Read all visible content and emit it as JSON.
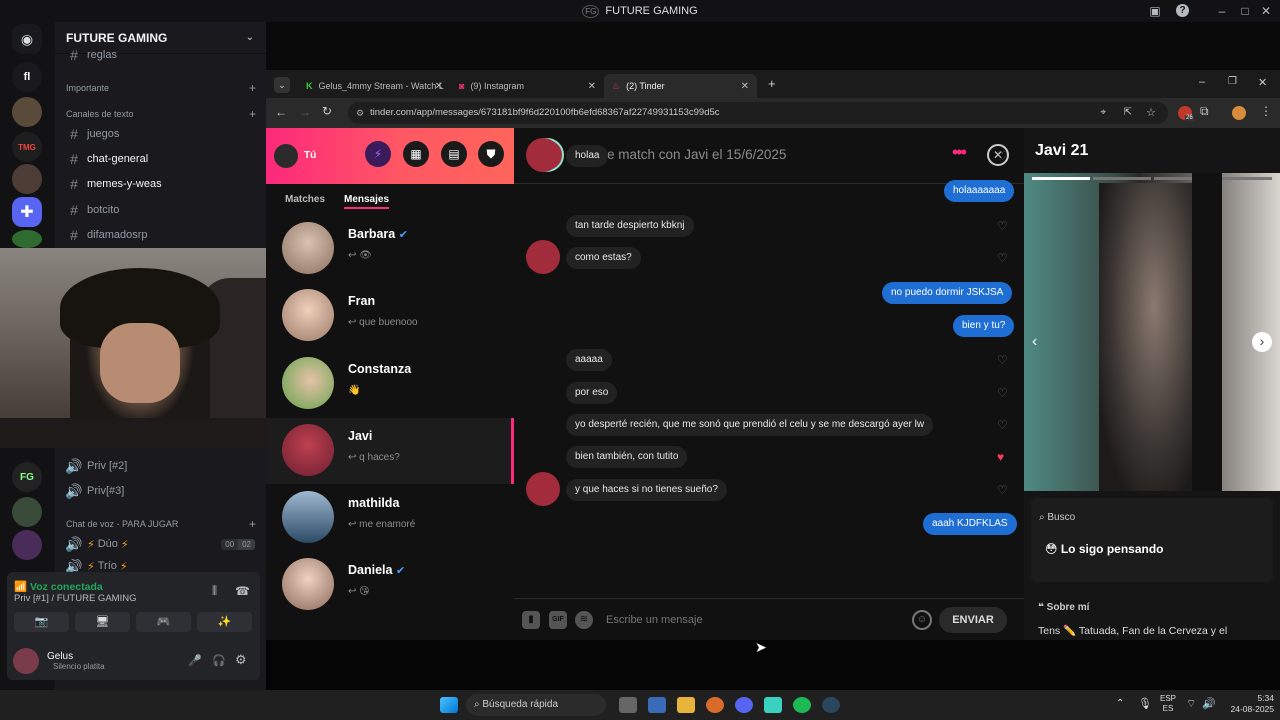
{
  "window": {
    "title": "FUTURE GAMING",
    "logo": "FG"
  },
  "discord": {
    "server_name": "FUTURE GAMING",
    "server_tags": {
      "tmg": "TMG",
      "fg": "FG"
    },
    "channels": [
      {
        "name": "reglas",
        "type": "text"
      },
      {
        "name": "juegos",
        "type": "text"
      },
      {
        "name": "chat-general",
        "type": "text"
      },
      {
        "name": "memes-y-weas",
        "type": "text"
      },
      {
        "name": "botcito",
        "type": "text"
      },
      {
        "name": "difamadosrp",
        "type": "text"
      }
    ],
    "categories": {
      "important": "Importante",
      "text_channels": "Canales de texto",
      "voice_channels": "Chat de voz - PARA JUGAR"
    },
    "voice_channels": [
      {
        "name": "Priv [#2]"
      },
      {
        "name": "Priv[#3]"
      },
      {
        "name": "Dúo",
        "count": "00",
        "limit": "02"
      },
      {
        "name": "Trío"
      }
    ],
    "voice_status": {
      "title": "Voz conectada",
      "channel": "Priv [#1] / FUTURE GAMING"
    },
    "user": {
      "name": "Gelus",
      "status": "Silencio platita"
    }
  },
  "browser": {
    "tabs": [
      {
        "label": "Gelus_4mmy Stream - Watch L"
      },
      {
        "label": "(9) Instagram"
      },
      {
        "label": "(2) Tinder",
        "active": true
      }
    ],
    "url": "tinder.com/app/messages/673181bf9f6d220100fb6efd6836​7af22749931153c99d5c",
    "ext_badge": "26"
  },
  "tinder": {
    "me_label": "Tú",
    "tabs": {
      "matches": "Matches",
      "messages": "Mensajes"
    },
    "conversations": [
      {
        "name": "Barbara",
        "preview": "",
        "verified": true,
        "emoji": "👁"
      },
      {
        "name": "Fran",
        "preview": "que buenooo"
      },
      {
        "name": "Constanza",
        "preview": "",
        "emoji": "👋"
      },
      {
        "name": "Javi",
        "preview": "q haces?",
        "active": true
      },
      {
        "name": "mathilda",
        "preview": "me enamoré"
      },
      {
        "name": "Daniela",
        "preview": "",
        "verified": true,
        "emoji": "😘"
      }
    ],
    "chat": {
      "header": "Hiciste match con Javi el 15/6/2025",
      "messages": [
        {
          "text": "holaa",
          "dir": "in",
          "avatar": true
        },
        {
          "text": "holaaaaaaa",
          "dir": "out"
        },
        {
          "text": "tan tarde despierto kbknj",
          "dir": "in"
        },
        {
          "text": "como estas?",
          "dir": "in",
          "avatar": true
        },
        {
          "text": "no puedo dormir JSKJSA",
          "dir": "out"
        },
        {
          "text": "bien y tu?",
          "dir": "out"
        },
        {
          "text": "aaaaa",
          "dir": "in"
        },
        {
          "text": "por eso",
          "dir": "in"
        },
        {
          "text": "yo desperté recién, que me sonó que prendió el celu y se me descargó ayer lw",
          "dir": "in"
        },
        {
          "text": "bien también, con tutito",
          "dir": "in",
          "liked": true
        },
        {
          "text": "y que haces si no tienes sueño?",
          "dir": "in",
          "avatar": true
        },
        {
          "text": "aaah KJDFKLAS",
          "dir": "out"
        }
      ],
      "placeholder": "Escribe un mensaje",
      "send_label": "ENVIAR",
      "gif_label": "GIF"
    },
    "profile": {
      "name_age": "Javi 21",
      "looking_label": "Busco",
      "looking_value": "Lo sigo pensando",
      "about_label": "Sobre mí",
      "about_text": "Tens ✏️ Tatuada, Fan de la Cerveza y el"
    }
  },
  "taskbar": {
    "search": "Búsqueda rápida",
    "lang": "ESP",
    "lang2": "ES",
    "time": "5:34",
    "date": "24-08-2025"
  },
  "colors": {
    "tinder_pink": "#fd297b",
    "tinder_orange": "#ff655b",
    "message_blue": "#1f6ed4",
    "discord_blurple": "#5865f2",
    "voice_green": "#23a55a"
  }
}
